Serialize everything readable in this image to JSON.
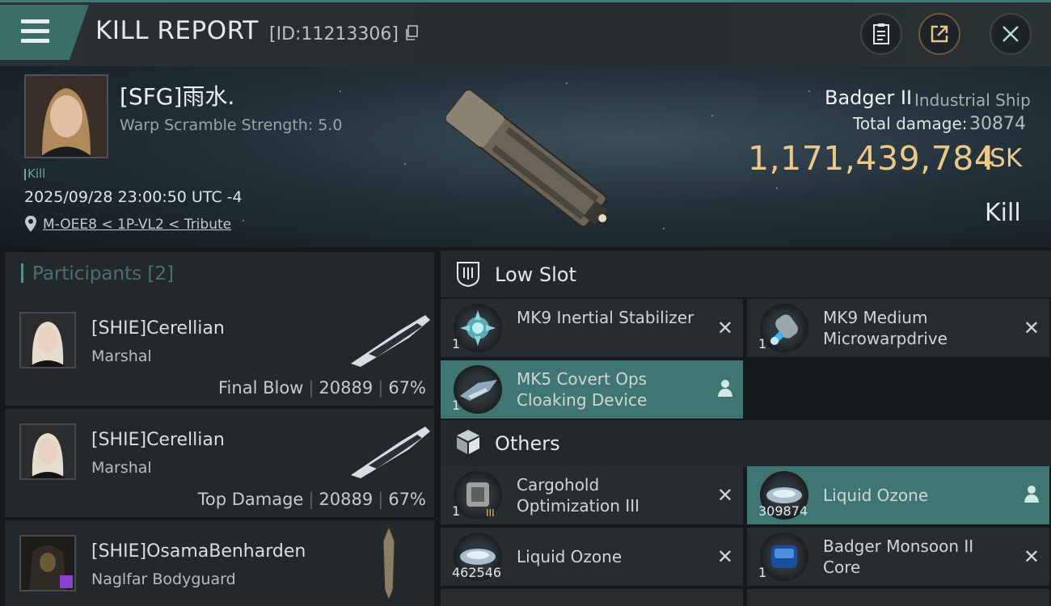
{
  "header": {
    "title": "KILL REPORT",
    "report_id": "[ID:11213306]",
    "buttons": [
      {
        "icon": "clipboard-icon"
      },
      {
        "icon": "share-icon"
      },
      {
        "icon": "close-icon"
      }
    ]
  },
  "victim": {
    "name": "[SFG]雨水.",
    "warp_scramble": "Warp Scramble Strength: 5.0",
    "kill_tag": "Kill",
    "datetime": "2025/09/28 23:00:50 UTC -4",
    "location": "M-OEE8 < 1P-VL2 < Tribute",
    "ship_name": "Badger II",
    "ship_class": "Industrial Ship",
    "total_damage_label": "Total damage:",
    "total_damage": "30874",
    "isk_value": "1,171,439,784",
    "isk_unit": "ISK",
    "result": "Kill"
  },
  "participants": {
    "title": "Participants [2]",
    "items": [
      {
        "name": "[SHIE]Cerellian",
        "role": "Marshal",
        "stat_label": "Final Blow",
        "damage": "20889",
        "percent": "67%"
      },
      {
        "name": "[SHIE]Cerellian",
        "role": "Marshal",
        "stat_label": "Top Damage",
        "damage": "20889",
        "percent": "67%"
      },
      {
        "name": "[SHIE]OsamaBenharden",
        "role": "Naglfar Bodyguard"
      }
    ]
  },
  "low_slot": {
    "title": "Low Slot",
    "items": [
      {
        "name": "MK9 Inertial Stabilizer",
        "qty": "1",
        "status": "destroyed"
      },
      {
        "name": "MK9 Medium Microwarpdrive",
        "qty": "1",
        "status": "destroyed"
      },
      {
        "name": "MK5 Covert Ops Cloaking Device",
        "qty": "1",
        "status": "dropped"
      }
    ]
  },
  "others": {
    "title": "Others",
    "items": [
      {
        "name": "Cargohold Optimization III",
        "qty": "1",
        "status": "destroyed"
      },
      {
        "name": "Liquid Ozone",
        "qty": "309874",
        "status": "dropped"
      },
      {
        "name": "Liquid Ozone",
        "qty": "462546",
        "status": "destroyed"
      },
      {
        "name": "Badger Monsoon II Core",
        "qty": "1",
        "status": "destroyed"
      }
    ]
  },
  "colors": {
    "accent": "#3f7671",
    "isk": "#ecc88a"
  }
}
